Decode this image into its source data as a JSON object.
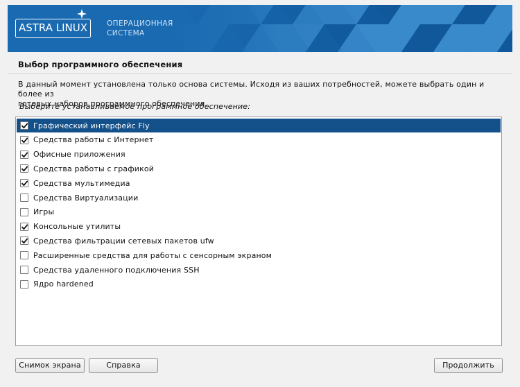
{
  "banner": {
    "logo_text": "ASTRA LINUX",
    "logo_mark": "®",
    "tagline_line1": "ОПЕРАЦИОННАЯ",
    "tagline_line2": "СИСТЕМА",
    "colors": {
      "background": "#1a6ab1",
      "pattern_light": "#3f8fd0",
      "pattern_dark": "#0f5597"
    }
  },
  "page": {
    "title": "Выбор программного обеспечения",
    "description_line1": "В данный момент установлена только основа системы. Исходя из ваших потребностей, можете выбрать один и более из",
    "description_line2": "готовых наборов программного обеспечения.",
    "prompt": "Выберите устанавливаемое программное обеспечение:"
  },
  "software_list": {
    "items": [
      {
        "label": "Графический интерфейс Fly",
        "checked": true,
        "selected": true
      },
      {
        "label": "Средства работы с Интернет",
        "checked": true,
        "selected": false
      },
      {
        "label": "Офисные приложения",
        "checked": true,
        "selected": false
      },
      {
        "label": "Средства работы с графикой",
        "checked": true,
        "selected": false
      },
      {
        "label": "Средства мультимедиа",
        "checked": true,
        "selected": false
      },
      {
        "label": "Средства Виртуализации",
        "checked": false,
        "selected": false
      },
      {
        "label": "Игры",
        "checked": false,
        "selected": false
      },
      {
        "label": "Консольные утилиты",
        "checked": true,
        "selected": false
      },
      {
        "label": "Средства фильтрации сетевых пакетов ufw",
        "checked": true,
        "selected": false
      },
      {
        "label": "Расширенные средства для работы с сенсорным экраном",
        "checked": false,
        "selected": false
      },
      {
        "label": "Средства удаленного подключения SSH",
        "checked": false,
        "selected": false
      },
      {
        "label": "Ядро hardened",
        "checked": false,
        "selected": false
      }
    ],
    "selected_color": "#14508a"
  },
  "buttons": {
    "screenshot": "Снимок экрана",
    "help": "Справка",
    "continue": "Продолжить"
  }
}
